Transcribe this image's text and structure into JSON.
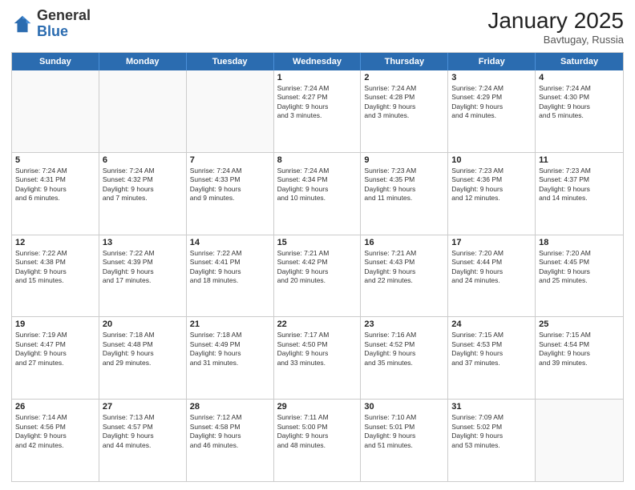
{
  "header": {
    "logo_general": "General",
    "logo_blue": "Blue",
    "title": "January 2025",
    "location": "Bavtugay, Russia"
  },
  "weekdays": [
    "Sunday",
    "Monday",
    "Tuesday",
    "Wednesday",
    "Thursday",
    "Friday",
    "Saturday"
  ],
  "weeks": [
    [
      {
        "day": "",
        "info": "",
        "empty": true
      },
      {
        "day": "",
        "info": "",
        "empty": true
      },
      {
        "day": "",
        "info": "",
        "empty": true
      },
      {
        "day": "1",
        "info": "Sunrise: 7:24 AM\nSunset: 4:27 PM\nDaylight: 9 hours\nand 3 minutes."
      },
      {
        "day": "2",
        "info": "Sunrise: 7:24 AM\nSunset: 4:28 PM\nDaylight: 9 hours\nand 3 minutes."
      },
      {
        "day": "3",
        "info": "Sunrise: 7:24 AM\nSunset: 4:29 PM\nDaylight: 9 hours\nand 4 minutes."
      },
      {
        "day": "4",
        "info": "Sunrise: 7:24 AM\nSunset: 4:30 PM\nDaylight: 9 hours\nand 5 minutes."
      }
    ],
    [
      {
        "day": "5",
        "info": "Sunrise: 7:24 AM\nSunset: 4:31 PM\nDaylight: 9 hours\nand 6 minutes."
      },
      {
        "day": "6",
        "info": "Sunrise: 7:24 AM\nSunset: 4:32 PM\nDaylight: 9 hours\nand 7 minutes."
      },
      {
        "day": "7",
        "info": "Sunrise: 7:24 AM\nSunset: 4:33 PM\nDaylight: 9 hours\nand 9 minutes."
      },
      {
        "day": "8",
        "info": "Sunrise: 7:24 AM\nSunset: 4:34 PM\nDaylight: 9 hours\nand 10 minutes."
      },
      {
        "day": "9",
        "info": "Sunrise: 7:23 AM\nSunset: 4:35 PM\nDaylight: 9 hours\nand 11 minutes."
      },
      {
        "day": "10",
        "info": "Sunrise: 7:23 AM\nSunset: 4:36 PM\nDaylight: 9 hours\nand 12 minutes."
      },
      {
        "day": "11",
        "info": "Sunrise: 7:23 AM\nSunset: 4:37 PM\nDaylight: 9 hours\nand 14 minutes."
      }
    ],
    [
      {
        "day": "12",
        "info": "Sunrise: 7:22 AM\nSunset: 4:38 PM\nDaylight: 9 hours\nand 15 minutes."
      },
      {
        "day": "13",
        "info": "Sunrise: 7:22 AM\nSunset: 4:39 PM\nDaylight: 9 hours\nand 17 minutes."
      },
      {
        "day": "14",
        "info": "Sunrise: 7:22 AM\nSunset: 4:41 PM\nDaylight: 9 hours\nand 18 minutes."
      },
      {
        "day": "15",
        "info": "Sunrise: 7:21 AM\nSunset: 4:42 PM\nDaylight: 9 hours\nand 20 minutes."
      },
      {
        "day": "16",
        "info": "Sunrise: 7:21 AM\nSunset: 4:43 PM\nDaylight: 9 hours\nand 22 minutes."
      },
      {
        "day": "17",
        "info": "Sunrise: 7:20 AM\nSunset: 4:44 PM\nDaylight: 9 hours\nand 24 minutes."
      },
      {
        "day": "18",
        "info": "Sunrise: 7:20 AM\nSunset: 4:45 PM\nDaylight: 9 hours\nand 25 minutes."
      }
    ],
    [
      {
        "day": "19",
        "info": "Sunrise: 7:19 AM\nSunset: 4:47 PM\nDaylight: 9 hours\nand 27 minutes."
      },
      {
        "day": "20",
        "info": "Sunrise: 7:18 AM\nSunset: 4:48 PM\nDaylight: 9 hours\nand 29 minutes."
      },
      {
        "day": "21",
        "info": "Sunrise: 7:18 AM\nSunset: 4:49 PM\nDaylight: 9 hours\nand 31 minutes."
      },
      {
        "day": "22",
        "info": "Sunrise: 7:17 AM\nSunset: 4:50 PM\nDaylight: 9 hours\nand 33 minutes."
      },
      {
        "day": "23",
        "info": "Sunrise: 7:16 AM\nSunset: 4:52 PM\nDaylight: 9 hours\nand 35 minutes."
      },
      {
        "day": "24",
        "info": "Sunrise: 7:15 AM\nSunset: 4:53 PM\nDaylight: 9 hours\nand 37 minutes."
      },
      {
        "day": "25",
        "info": "Sunrise: 7:15 AM\nSunset: 4:54 PM\nDaylight: 9 hours\nand 39 minutes."
      }
    ],
    [
      {
        "day": "26",
        "info": "Sunrise: 7:14 AM\nSunset: 4:56 PM\nDaylight: 9 hours\nand 42 minutes."
      },
      {
        "day": "27",
        "info": "Sunrise: 7:13 AM\nSunset: 4:57 PM\nDaylight: 9 hours\nand 44 minutes."
      },
      {
        "day": "28",
        "info": "Sunrise: 7:12 AM\nSunset: 4:58 PM\nDaylight: 9 hours\nand 46 minutes."
      },
      {
        "day": "29",
        "info": "Sunrise: 7:11 AM\nSunset: 5:00 PM\nDaylight: 9 hours\nand 48 minutes."
      },
      {
        "day": "30",
        "info": "Sunrise: 7:10 AM\nSunset: 5:01 PM\nDaylight: 9 hours\nand 51 minutes."
      },
      {
        "day": "31",
        "info": "Sunrise: 7:09 AM\nSunset: 5:02 PM\nDaylight: 9 hours\nand 53 minutes."
      },
      {
        "day": "",
        "info": "",
        "empty": true
      }
    ]
  ]
}
